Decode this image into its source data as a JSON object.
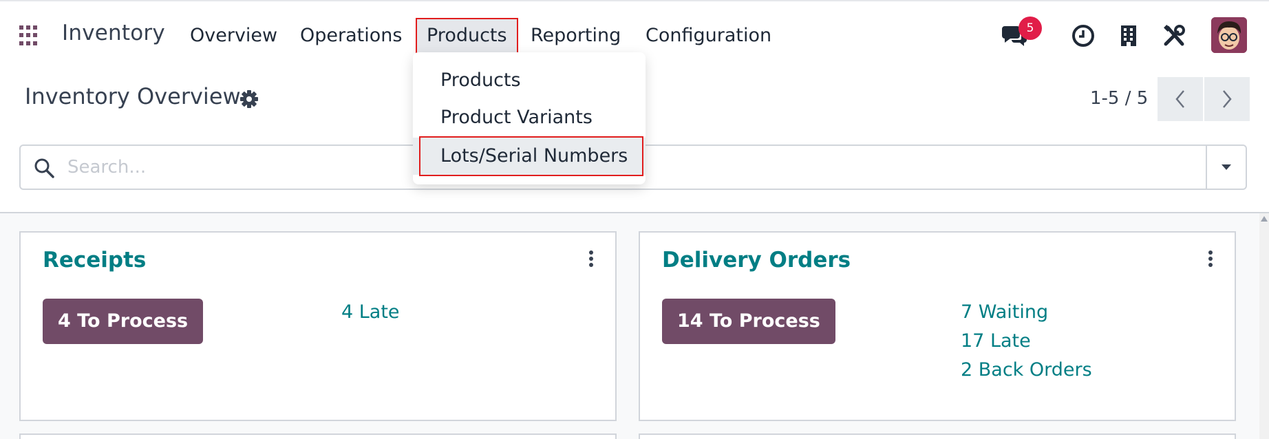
{
  "navbar": {
    "brand": "Inventory",
    "menus": [
      "Overview",
      "Operations",
      "Products",
      "Reporting",
      "Configuration"
    ],
    "active_menu": "Products",
    "messages_badge": "5",
    "icons": [
      "apps-grid-icon",
      "chat-icon",
      "clock-icon",
      "building-icon",
      "tools-icon"
    ]
  },
  "products_dropdown": {
    "items": [
      "Products",
      "Product Variants",
      "Lots/Serial Numbers"
    ],
    "highlighted": "Lots/Serial Numbers"
  },
  "control_panel": {
    "title": "Inventory Overview",
    "pager": "1-5 / 5",
    "search_placeholder": "Search..."
  },
  "cards": [
    {
      "title": "Receipts",
      "button": "4 To Process",
      "stats": [
        "4 Late"
      ]
    },
    {
      "title": "Delivery Orders",
      "button": "14 To Process",
      "stats": [
        "7 Waiting",
        "17 Late",
        "2 Back Orders"
      ]
    }
  ],
  "colors": {
    "brand_purple": "#714b67",
    "link_teal": "#017e84",
    "badge_red": "#e11d48",
    "highlight_red": "#e11d1d"
  }
}
